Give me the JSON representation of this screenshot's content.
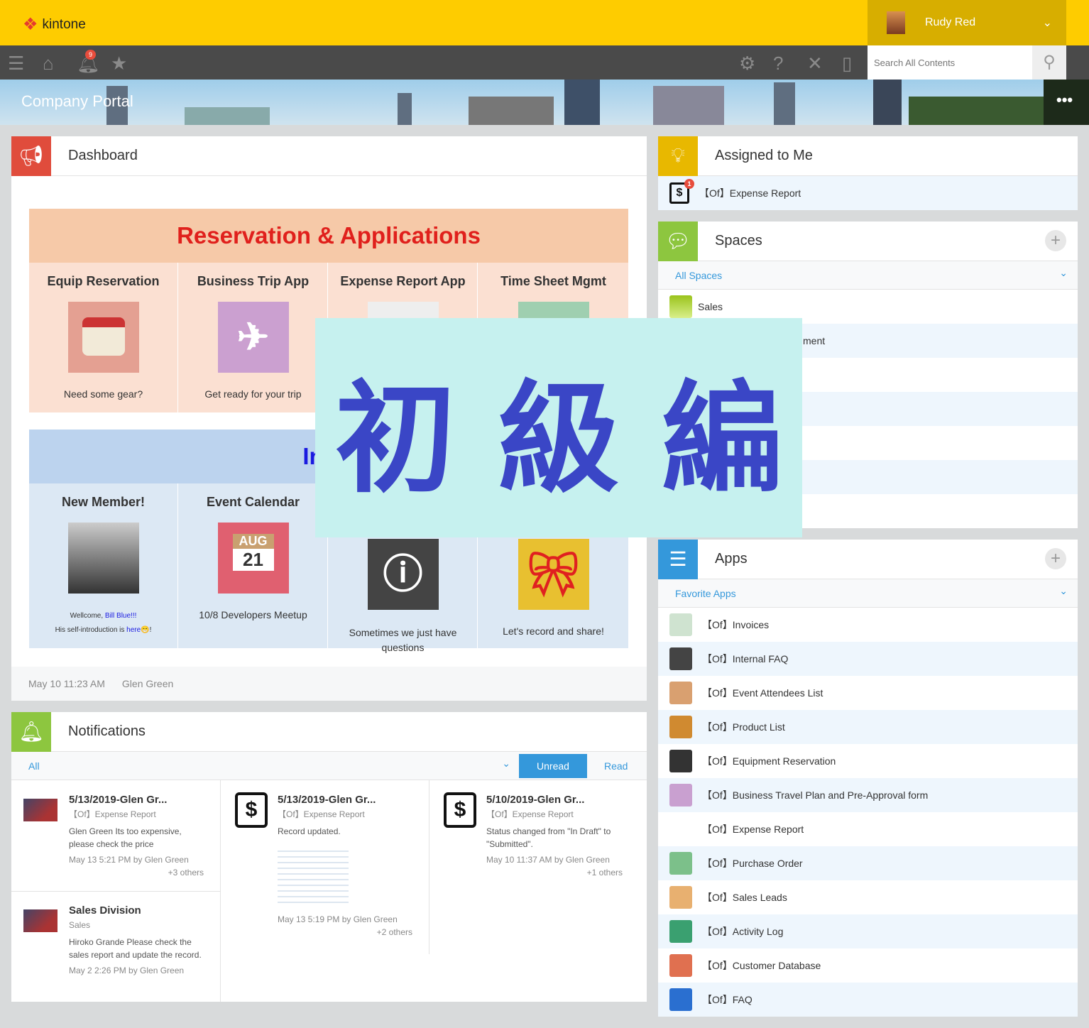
{
  "header": {
    "brand": "kintone",
    "user": "Rudy Red",
    "notification_count": "9",
    "search_placeholder": "Search All Contents",
    "portal_title": "Company Portal"
  },
  "dashboard": {
    "title": "Dashboard",
    "res_title": "Reservation & Applications",
    "res_items": [
      {
        "title": "Equip Reservation",
        "caption": "Need some gear?"
      },
      {
        "title": "Business Trip App",
        "caption": "Get ready for your trip"
      },
      {
        "title": "Expense Report App",
        "caption": ""
      },
      {
        "title": "Time Sheet  Mgmt",
        "caption": ""
      }
    ],
    "info_title": "Infor",
    "info_items": [
      {
        "title": "New Member!",
        "caption1": "Wellcome, ",
        "name": "Bill Blue!!!",
        "caption2": "His self-introduction is ",
        "link": "here",
        "end": "!"
      },
      {
        "title": "Event Calendar",
        "caption": "10/8 Developers Meetup",
        "cal_month": "AUG",
        "cal_day": "21"
      },
      {
        "title": "",
        "caption": "Sometimes we just have questions"
      },
      {
        "title": "",
        "caption": "Let's record and share!"
      }
    ],
    "date": "May 10 11:23 AM",
    "author": "Glen Green"
  },
  "notifications": {
    "title": "Notifications",
    "filter": "All",
    "unread": "Unread",
    "read": "Read",
    "items": [
      {
        "title": "5/13/2019-Glen Gr...",
        "app": "【Of】Expense Report",
        "body": "Glen Green Its too expensive, please check the price",
        "meta": "May 13 5:21 PM  by Glen Green",
        "others": "+3 others"
      },
      {
        "title": "Sales Division",
        "app": "Sales",
        "body": "Hiroko Grande Please check the sales report and update the record.",
        "meta": "May 2 2:26 PM  by Glen Green",
        "others": ""
      },
      {
        "title": "5/13/2019-Glen Gr...",
        "app": "【Of】Expense Report",
        "body": "Record updated.",
        "meta": "May 13 5:19 PM  by Glen Green",
        "others": "+2 others"
      },
      {
        "title": "5/10/2019-Glen Gr...",
        "app": "【Of】Expense Report",
        "body": "Status changed from \"In Draft\" to \"Submitted\".",
        "meta": "May 10 11:37 AM  by Glen Green",
        "others": "+1 others"
      }
    ]
  },
  "assigned": {
    "title": "Assigned to Me",
    "badge": "1",
    "items": [
      "【Of】Expense Report"
    ]
  },
  "spaces": {
    "title": "Spaces",
    "filter": "All Spaces",
    "items": [
      "Sales",
      "ment"
    ]
  },
  "apps": {
    "title": "Apps",
    "filter": "Favorite Apps",
    "items": [
      {
        "label": "【Of】Invoices",
        "icon": "invoice-icon",
        "color": "#cfe3d0"
      },
      {
        "label": "【Of】Internal FAQ",
        "icon": "info-icon",
        "color": "#444444"
      },
      {
        "label": "【Of】Event Attendees List",
        "icon": "person-icon",
        "color": "#d9a070"
      },
      {
        "label": "【Of】Product List",
        "icon": "box-icon",
        "color": "#d08a30"
      },
      {
        "label": "【Of】Equipment Reservation",
        "icon": "camera-icon",
        "color": "#333333"
      },
      {
        "label": "【Of】Business Travel Plan and Pre-Approval form",
        "icon": "airplane-icon",
        "color": "#c9a0d0"
      },
      {
        "label": "【Of】Expense Report",
        "icon": "dollar-icon",
        "color": "#ffffff"
      },
      {
        "label": "【Of】Purchase Order",
        "icon": "basket-icon",
        "color": "#7cc08a"
      },
      {
        "label": "【Of】Sales Leads",
        "icon": "chart-icon",
        "color": "#e8b070"
      },
      {
        "label": "【Of】Activity Log",
        "icon": "calendar-icon",
        "color": "#3aa070"
      },
      {
        "label": "【Of】Customer Database",
        "icon": "folders-icon",
        "color": "#e07050"
      },
      {
        "label": "【Of】FAQ",
        "icon": "help-icon",
        "color": "#2a6fd0"
      }
    ]
  },
  "overlay": {
    "chars": [
      "初",
      "級",
      "編"
    ]
  }
}
